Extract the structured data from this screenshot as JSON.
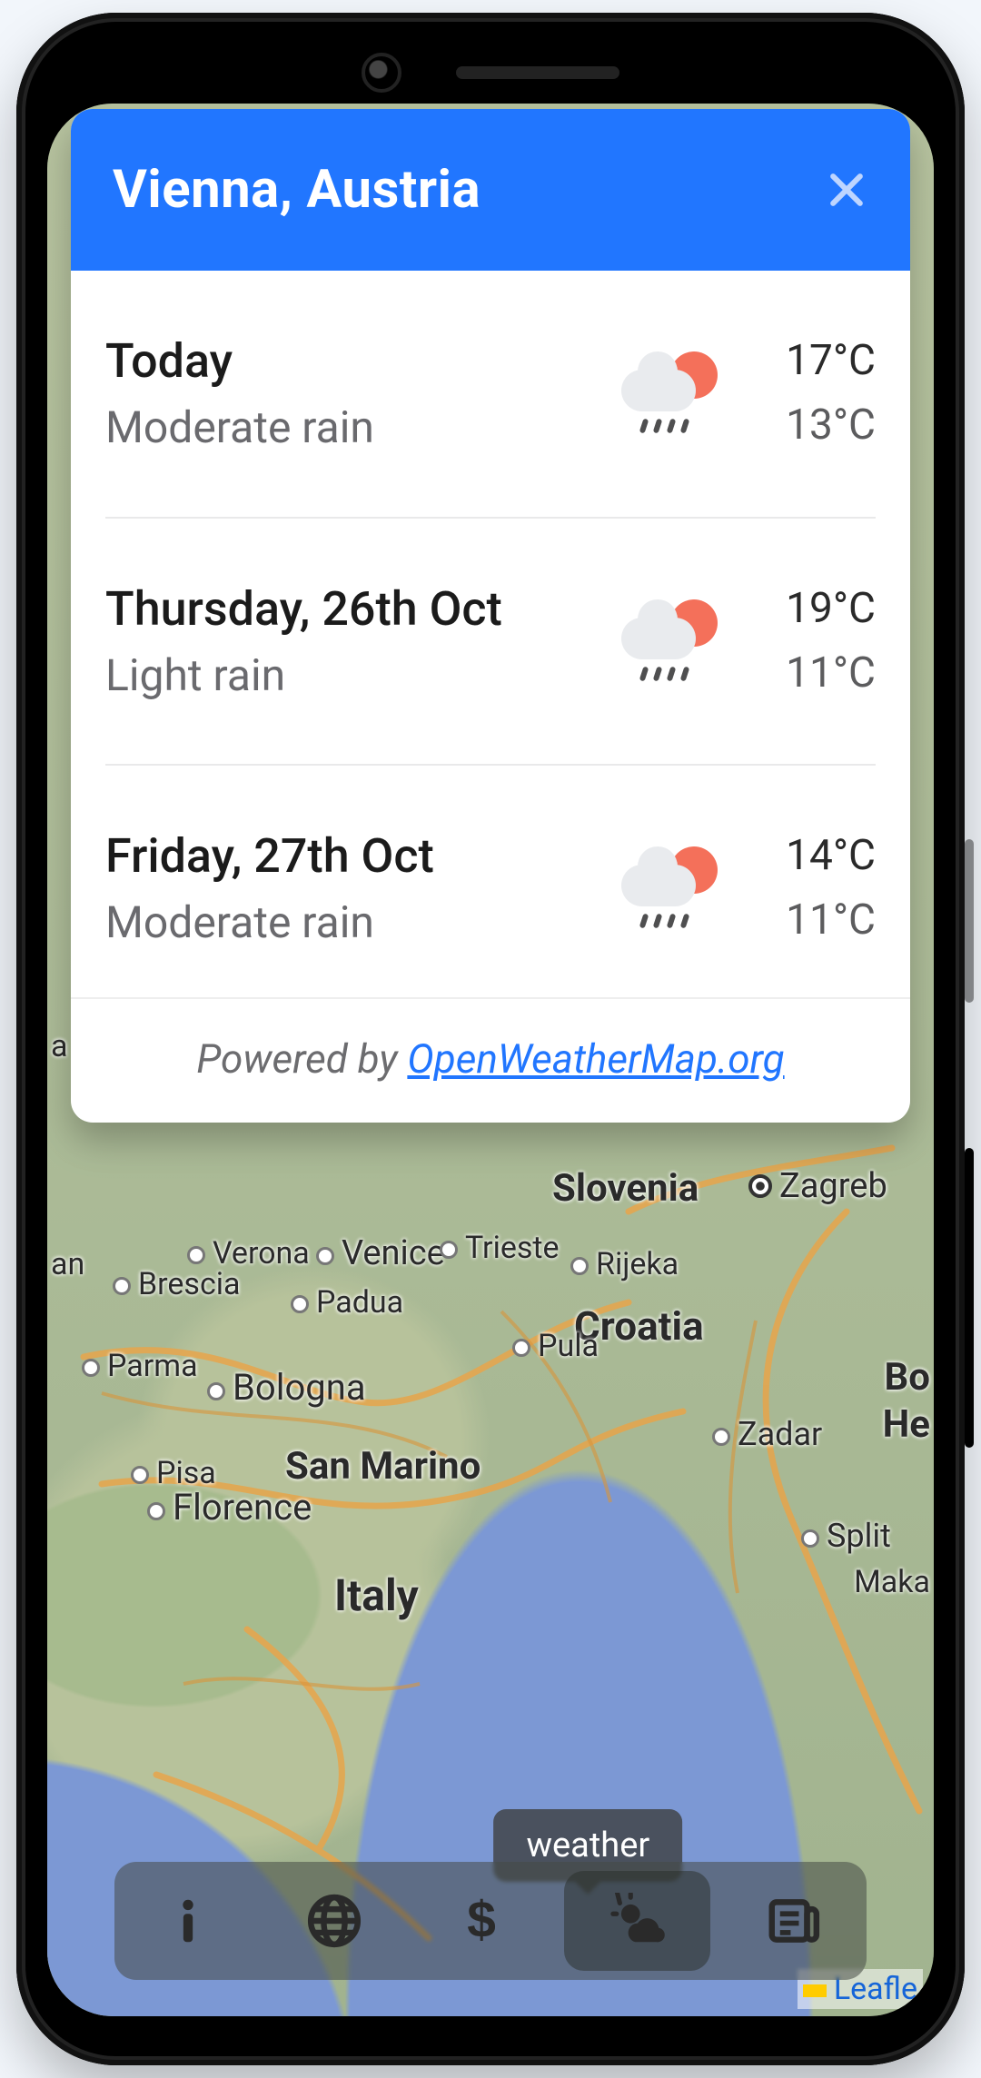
{
  "card": {
    "title": "Vienna, Austria",
    "days": [
      {
        "name": "Today",
        "desc": "Moderate rain",
        "high": "17°C",
        "low": "13°C"
      },
      {
        "name": "Thursday, 26th Oct",
        "desc": "Light rain",
        "high": "19°C",
        "low": "11°C"
      },
      {
        "name": "Friday, 27th Oct",
        "desc": "Moderate rain",
        "high": "14°C",
        "low": "11°C"
      }
    ],
    "footer_prefix": "Powered by ",
    "footer_link": "OpenWeatherMap.org"
  },
  "map": {
    "attribution": "Leafle",
    "labels": {
      "slovenia": "Slovenia",
      "croatia": "Croatia",
      "italy": "Italy",
      "bo": "Bo",
      "he": "He",
      "zagreb": "Zagreb",
      "venice": "Venice",
      "trieste": "Trieste",
      "rijeka": "Rijeka",
      "padua": "Padua",
      "verona": "Verona",
      "brescia": "Brescia",
      "pula": "Pula",
      "bologna": "Bologna",
      "zadar": "Zadar",
      "parma": "Parma",
      "sanmarino": "San Marino",
      "florence": "Florence",
      "pisa": "Pisa",
      "split": "Split",
      "maka": "Maka",
      "an": "an",
      "a": "a"
    }
  },
  "toolbar": {
    "tooltip": "weather",
    "items": [
      {
        "id": "info",
        "name": "info-button"
      },
      {
        "id": "web",
        "name": "globe-button"
      },
      {
        "id": "money",
        "name": "currency-button"
      },
      {
        "id": "weather",
        "name": "weather-button"
      },
      {
        "id": "news",
        "name": "news-button"
      }
    ],
    "active": "weather"
  }
}
